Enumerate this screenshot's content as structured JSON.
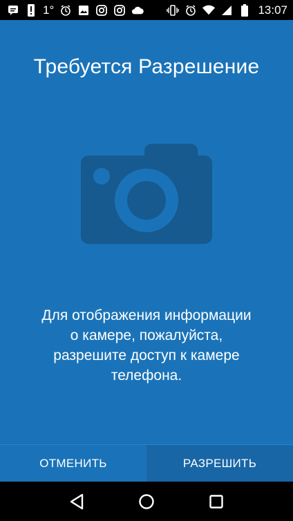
{
  "status_bar": {
    "left_icons": [
      "chat-icon",
      "alert-icon"
    ],
    "temperature": "1°",
    "right_more_icons": [
      "alarm-icon",
      "image-icon",
      "instagram-icon",
      "instagram-icon",
      "cloud-icon"
    ],
    "system_icons": [
      "vibrate-icon",
      "alarm-icon",
      "wifi-icon",
      "signal-icon",
      "battery-icon"
    ],
    "time": "13:07"
  },
  "dialog": {
    "title": "Требуется Разрешение",
    "icon": "camera-icon",
    "message_lines": [
      "Для отображения информации",
      "о камере, пожалуйста,",
      "разрешите доступ к камере",
      "телефона."
    ],
    "cancel_label": "ОТМЕНИТЬ",
    "allow_label": "РАЗРЕШИТЬ"
  },
  "nav_bar": {
    "icons": [
      "back-icon",
      "home-icon",
      "recents-icon"
    ]
  },
  "colors": {
    "background": "#1a73b8",
    "camera": "#175a8f",
    "allow_button": "#1866a6"
  }
}
